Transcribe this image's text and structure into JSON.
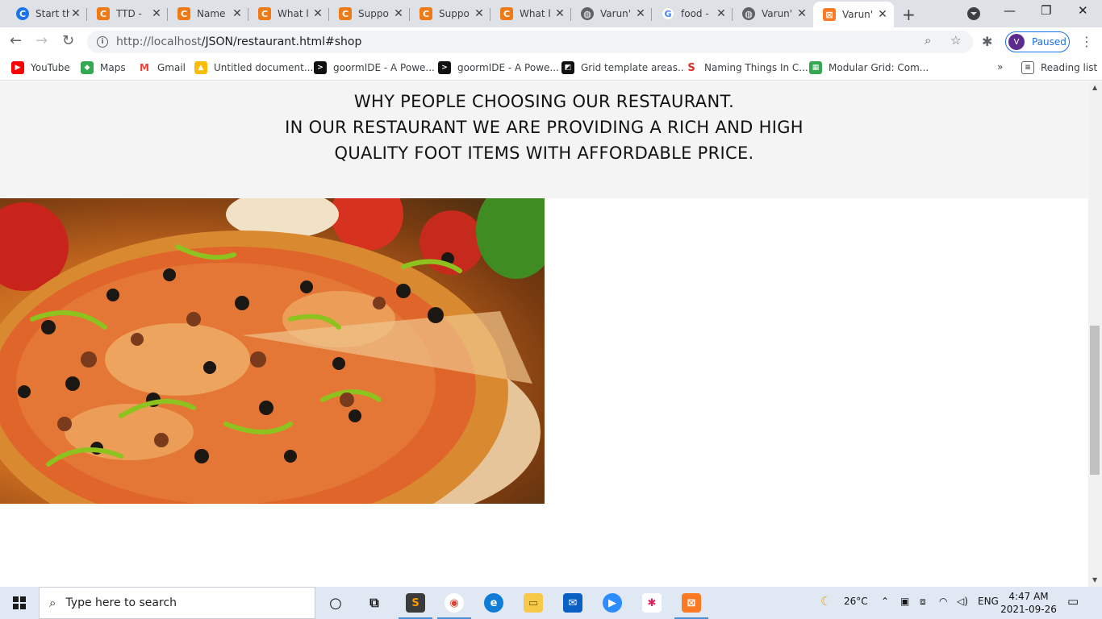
{
  "browser": {
    "tabs": [
      {
        "title": "Start th",
        "icon": "chrome-icon"
      },
      {
        "title": "TTD -",
        "icon": "c-orange-icon"
      },
      {
        "title": "Name",
        "icon": "c-orange-icon"
      },
      {
        "title": "What l",
        "icon": "c-orange-icon"
      },
      {
        "title": "Suppo",
        "icon": "c-orange-icon"
      },
      {
        "title": "Suppo",
        "icon": "c-orange-icon"
      },
      {
        "title": "What l",
        "icon": "c-orange-icon"
      },
      {
        "title": "Varun'",
        "icon": "globe-icon"
      },
      {
        "title": "food -",
        "icon": "google-icon"
      },
      {
        "title": "Varun'",
        "icon": "globe-icon"
      },
      {
        "title": "Varun'",
        "icon": "xampp-icon",
        "active": true
      }
    ],
    "url_host": "http://localhost",
    "url_path": "/JSON/restaurant.html#shop",
    "profile_initial": "V",
    "profile_status": "Paused",
    "bookmarks": [
      {
        "label": "YouTube",
        "color": "#ff0000"
      },
      {
        "label": "Maps",
        "color": "#34a853"
      },
      {
        "label": "Gmail",
        "color": "#ea4335"
      },
      {
        "label": "Untitled document...",
        "color": "#fbbc04"
      },
      {
        "label": "goormIDE - A Powe...",
        "color": "#111111"
      },
      {
        "label": "goormIDE - A Powe...",
        "color": "#111111"
      },
      {
        "label": "Grid template areas...",
        "color": "#111111"
      },
      {
        "label": "Naming Things In C...",
        "color": "#d93025"
      },
      {
        "label": "Modular Grid: Com...",
        "color": "#34a853"
      }
    ],
    "bookmarks_overflow": "»",
    "reading_list": "Reading list"
  },
  "page": {
    "why_line1": "WHY PEOPLE CHOOSING OUR RESTAURANT.",
    "why_line2": "IN OUR RESTAURANT WE ARE PROVIDING A RICH AND HIGH",
    "why_line3": "QUALITY FOOT ITEMS WITH AFFORDABLE PRICE.",
    "image_subject": "pizza"
  },
  "taskbar": {
    "search_placeholder": "Type here to search",
    "weather": "26°C",
    "language": "ENG",
    "time": "4:47 AM",
    "date": "2021-09-26"
  }
}
